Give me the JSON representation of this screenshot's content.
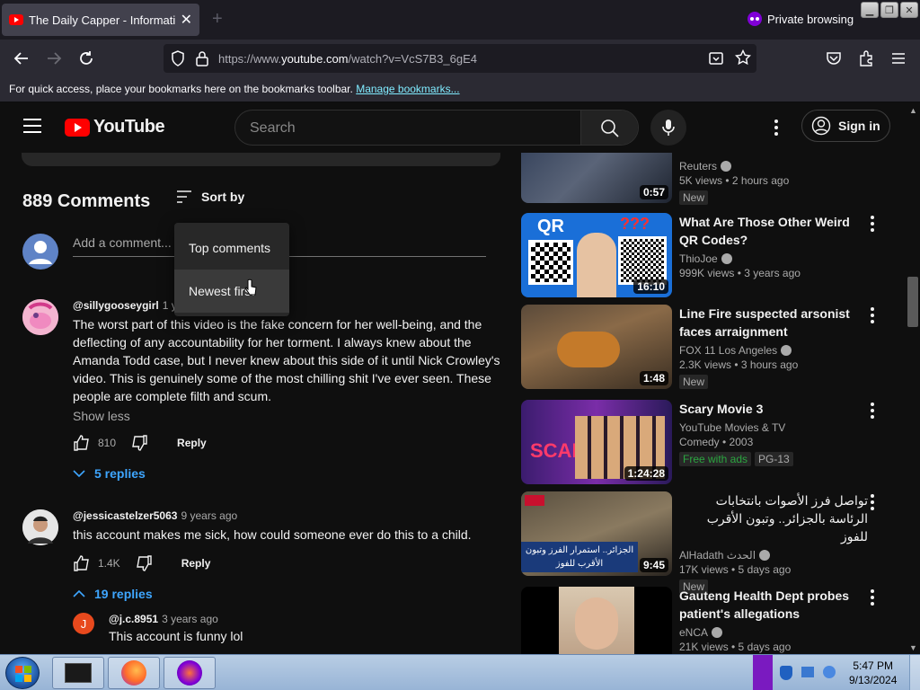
{
  "browser": {
    "tab_title": "The Daily Capper - Information",
    "private_label": "Private browsing",
    "url_prefix": "https://www.",
    "url_domain": "youtube.com",
    "url_path": "/watch?v=VcS7B3_6gE4",
    "bookmarks_text": "For quick access, place your bookmarks here on the bookmarks toolbar.",
    "bookmarks_link": "Manage bookmarks..."
  },
  "youtube": {
    "logo_text": "YouTube",
    "search_placeholder": "Search",
    "sign_in": "Sign in",
    "brand_color": "#ff0000"
  },
  "comments": {
    "count_label": "889 Comments",
    "sort_label": "Sort by",
    "add_placeholder": "Add a comment...",
    "sort_menu": [
      "Top comments",
      "Newest first"
    ],
    "items": [
      {
        "user": "@sillygooseygirl",
        "time": "1 y",
        "text": "The worst part of this video is the fake concern for her well-being, and the deflecting of any accountability for her torment. I always knew about the Amanda Todd case, but I never knew about this side of it until Nick Crowley's video. This is genuinely some of the most chilling shit I've ever seen. These people are complete filth and scum.",
        "show_less": "Show less",
        "likes": "810",
        "reply": "Reply",
        "replies": "5 replies"
      },
      {
        "user": "@jessicastelzer5063",
        "time": "9 years ago",
        "text": "this account makes me sick, how could someone ever do this to a child.",
        "likes": "1.4K",
        "reply": "Reply",
        "replies": "19 replies"
      },
      {
        "user": "@j.c.8951",
        "time": "3 years ago",
        "text": "This account is funny lol",
        "avatar_letter": "J"
      }
    ]
  },
  "sidebar": {
    "videos": [
      {
        "title": "",
        "channel": "Reuters",
        "stats": "5K views • 2 hours ago",
        "badges": [
          "New"
        ],
        "duration": "0:57"
      },
      {
        "title": "What Are Those Other Weird QR Codes?",
        "channel": "ThioJoe",
        "stats": "999K views • 3 years ago",
        "badges": [],
        "duration": "16:10",
        "thumb_text": "QR",
        "thumb_text2": "???"
      },
      {
        "title": "Line Fire suspected arsonist faces arraignment",
        "channel": "FOX 11 Los Angeles",
        "stats": "2.3K views • 3 hours ago",
        "badges": [
          "New"
        ],
        "duration": "1:48"
      },
      {
        "title": "Scary Movie 3",
        "channel": "YouTube Movies & TV",
        "stats": "Comedy • 2003",
        "badges": [
          "Free with ads",
          "PG-13"
        ],
        "duration": "1:24:28"
      },
      {
        "title": "تواصل فرز الأصوات بانتخابات الرئاسة بالجزائر.. وتبون الأقرب للفوز",
        "channel": "AlHadath الحدث",
        "stats": "17K views • 5 days ago",
        "badges": [
          "New"
        ],
        "duration": "9:45",
        "thumb_caption": "الجزائر.. استمرار الفرز وتبون الأقرب للفوز"
      },
      {
        "title": "Gauteng Health Dept probes patient's allegations",
        "channel": "eNCA",
        "stats": "21K views • 5 days ago",
        "badges": [],
        "duration": ""
      }
    ]
  },
  "taskbar": {
    "time": "5:47 PM",
    "date": "9/13/2024"
  }
}
